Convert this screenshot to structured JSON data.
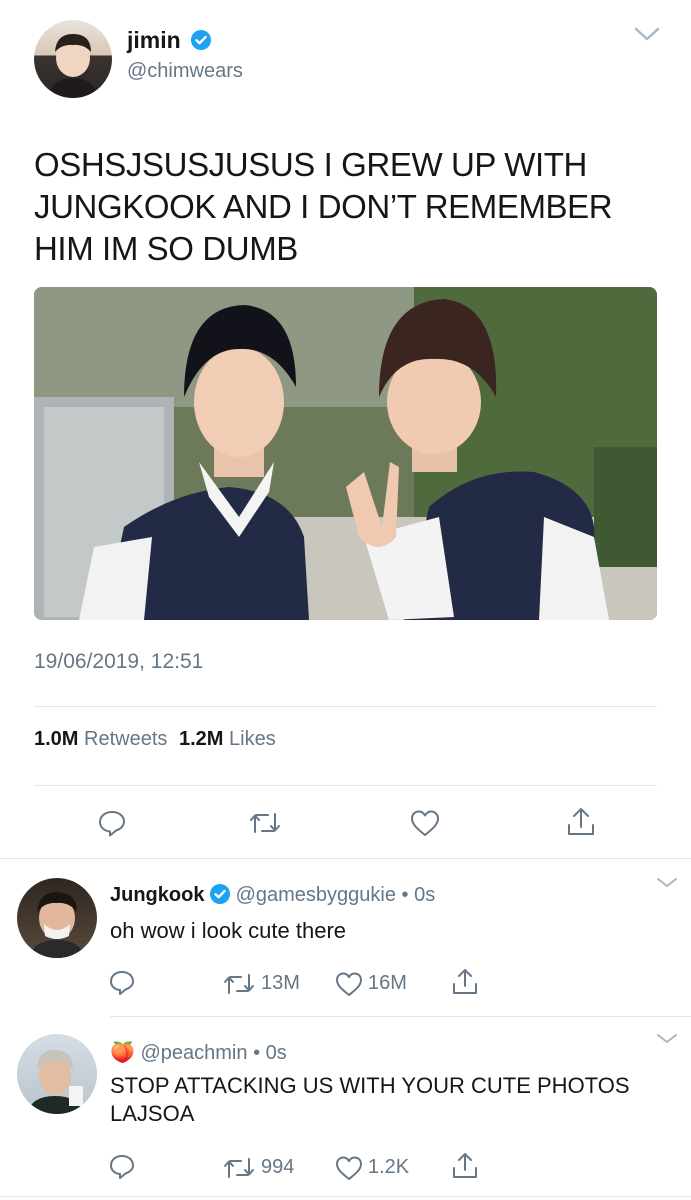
{
  "main_tweet": {
    "display_name": "jimin",
    "handle": "@chimwears",
    "text": "OSHSJSUSJUSUS I GREW UP WITH JUNGKOOK AND I DON’T REMEMBER HIM IM SO DUMB",
    "timestamp": "19/06/2019, 12:51",
    "retweets_count": "1.0M",
    "retweets_label": "Retweets",
    "likes_count": "1.2M",
    "likes_label": "Likes",
    "photo_icon": "photo-of-two-boys-in-school-uniform"
  },
  "replies": [
    {
      "display_name": "Jungkook",
      "verified": true,
      "handle": "@gamesbyggukie",
      "time": "0s",
      "text": "oh wow i look cute there",
      "retweets": "13M",
      "likes": "16M"
    },
    {
      "display_name": "🍑",
      "verified": false,
      "handle": "@peachmin",
      "time": "0s",
      "text": "STOP ATTACKING US WITH YOUR CUTE PHOTOS LAJSOA",
      "retweets": "994",
      "likes": "1.2K"
    }
  ],
  "colors": {
    "verified": "#1da1f2",
    "muted": "#657786",
    "divider": "#e1e8ed"
  }
}
